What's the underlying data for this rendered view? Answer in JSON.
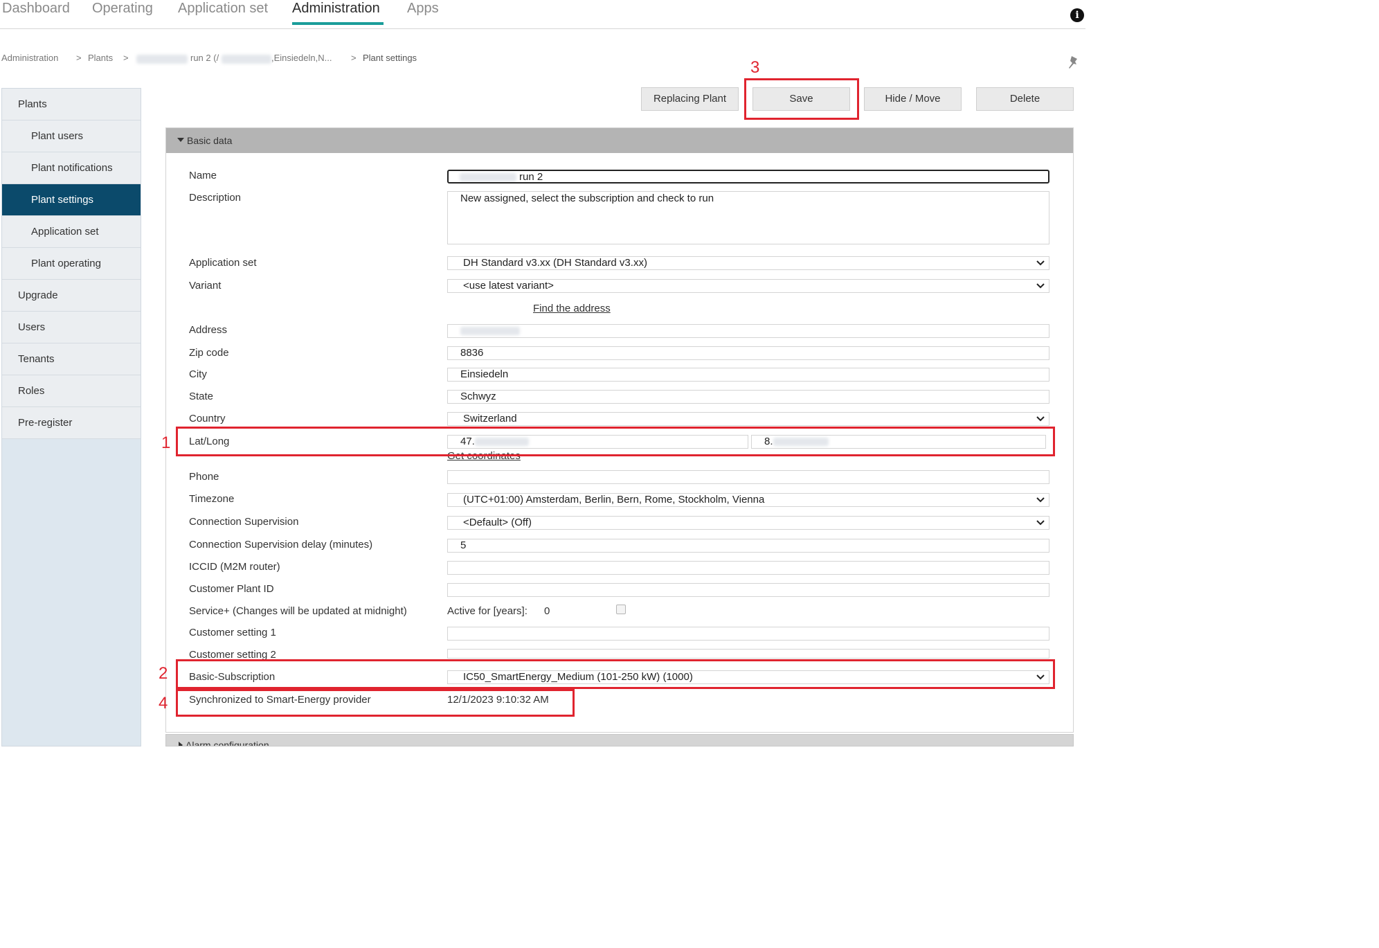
{
  "nav": {
    "tabs": [
      "Dashboard",
      "Operating",
      "Application set",
      "Administration",
      "Apps"
    ],
    "active": "Administration"
  },
  "breadcrumb": {
    "administration": "Administration",
    "plants": "Plants",
    "plant_name_visible": "run 2 (/",
    "plant_location": ",Einsiedeln,N...",
    "current": "Plant settings",
    "separator": ">"
  },
  "sidebar": {
    "items": [
      "Plants",
      "Plant users",
      "Plant notifications",
      "Plant settings",
      "Application set",
      "Plant operating",
      "Upgrade",
      "Users",
      "Tenants",
      "Roles",
      "Pre-register"
    ],
    "active": "Plant settings"
  },
  "toolbar": {
    "replacing_plant": "Replacing Plant",
    "save": "Save",
    "hide_move": "Hide / Move",
    "delete": "Delete"
  },
  "annotations": [
    "1",
    "2",
    "3",
    "4"
  ],
  "section": {
    "basic_data": "Basic data",
    "alarm_configuration": "Alarm configuration"
  },
  "form": {
    "name_label": "Name",
    "name_value": "run 2",
    "description_label": "Description",
    "description_value": "New assigned, select the subscription and check to run",
    "application_set_label": "Application set",
    "application_set_value": "DH Standard v3.xx (DH Standard v3.xx)",
    "variant_label": "Variant",
    "variant_value": "<use latest variant>",
    "find_address": "Find the address",
    "address_label": "Address",
    "zip_label": "Zip code",
    "zip_value": "8836",
    "city_label": "City",
    "city_value": "Einsiedeln",
    "state_label": "State",
    "state_value": "Schwyz",
    "country_label": "Country",
    "country_value": "Switzerland",
    "latlong_label": "Lat/Long",
    "lat_value": "47.",
    "long_value": "8.",
    "get_coordinates": "Get coordinates",
    "phone_label": "Phone",
    "timezone_label": "Timezone",
    "timezone_value": "(UTC+01:00) Amsterdam, Berlin, Bern, Rome, Stockholm, Vienna",
    "conn_sup_label": "Connection Supervision",
    "conn_sup_value": "<Default> (Off)",
    "conn_delay_label": "Connection Supervision delay (minutes)",
    "conn_delay_value": "5",
    "iccid_label": "ICCID (M2M router)",
    "customer_plant_id_label": "Customer Plant ID",
    "service_label": "Service+ (Changes will be updated at midnight)",
    "active_for_label": "Active for [years]:",
    "active_for_value": "0",
    "customer_setting1_label": "Customer setting 1",
    "customer_setting2_label": "Customer setting 2",
    "basic_sub_label": "Basic-Subscription",
    "basic_sub_value": "IC50_SmartEnergy_Medium (101-250 kW) (1000)",
    "sync_label": "Synchronized to Smart-Energy provider",
    "sync_value": "12/1/2023 9:10:32 AM"
  },
  "colors": {
    "accent_tab": "#1a9d9a",
    "sidebar_active": "#0b4a6b",
    "annotation_red": "#e0242f",
    "panel_header": "#b4b4b4"
  }
}
